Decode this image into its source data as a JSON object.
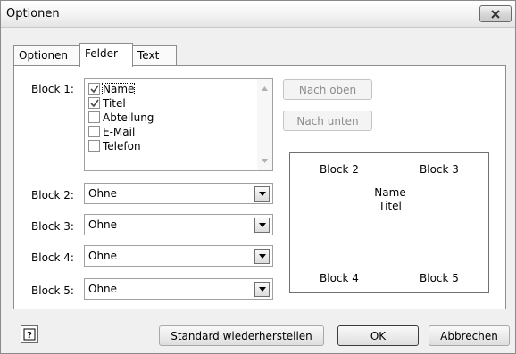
{
  "dialog": {
    "title": "Optionen",
    "close_icon": "close-icon"
  },
  "tabs": [
    {
      "label": "Optionen",
      "active": false
    },
    {
      "label": "Felder",
      "active": true
    },
    {
      "label": "Text",
      "active": false
    }
  ],
  "block1": {
    "label": "Block 1:",
    "items": [
      {
        "label": "Name",
        "checked": true,
        "focused": true
      },
      {
        "label": "Titel",
        "checked": true,
        "focused": false
      },
      {
        "label": "Abteilung",
        "checked": false,
        "focused": false
      },
      {
        "label": "E-Mail",
        "checked": false,
        "focused": false
      },
      {
        "label": "Telefon",
        "checked": false,
        "focused": false
      }
    ]
  },
  "buttons": {
    "move_up": "Nach oben",
    "move_down": "Nach unten",
    "restore_default": "Standard wiederherstellen",
    "ok": "OK",
    "cancel": "Abbrechen"
  },
  "blocks": [
    {
      "label": "Block 2:",
      "value": "Ohne"
    },
    {
      "label": "Block 3:",
      "value": "Ohne"
    },
    {
      "label": "Block 4:",
      "value": "Ohne"
    },
    {
      "label": "Block 5:",
      "value": "Ohne"
    }
  ],
  "preview": {
    "block2": "Block 2",
    "block3": "Block 3",
    "name": "Name",
    "title": "Titel",
    "block4": "Block 4",
    "block5": "Block 5"
  },
  "help_icon": "help-icon"
}
